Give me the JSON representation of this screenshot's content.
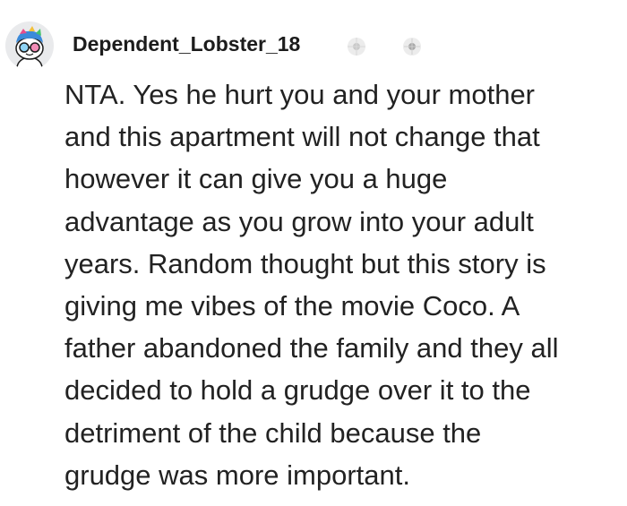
{
  "comment": {
    "author": "Dependent_Lobster_18",
    "body_lines": [
      "NTA. Yes he hurt you and your mother",
      "and this apartment will not change that",
      "however it can give you a huge",
      "advantage as you grow into your adult",
      "years. Random thought but this story is",
      "giving me vibes of the movie Coco. A",
      "father abandoned the family and they all",
      "decided to hold a grudge over it to the",
      "detriment of the child because the",
      "grudge was more important."
    ],
    "avatar": "snoo-avatar-icon",
    "awards": [
      "award-icon",
      "award-icon"
    ]
  },
  "colors": {
    "text": "#222222",
    "username": "#1c1c1c",
    "background": "#ffffff",
    "avatar_bg": "#e9eaec"
  }
}
